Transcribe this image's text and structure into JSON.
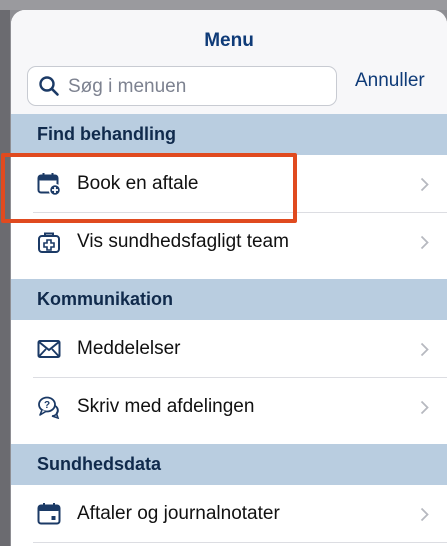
{
  "header": {
    "title": "Menu",
    "search_placeholder": "Søg i menuen",
    "cancel_label": "Annuller"
  },
  "sections": [
    {
      "title": "Find behandling",
      "items": [
        {
          "label": "Book en aftale",
          "icon": "calendar-plus-icon"
        },
        {
          "label": "Vis sundhedsfagligt team",
          "icon": "medical-bag-icon"
        }
      ]
    },
    {
      "title": "Kommunikation",
      "items": [
        {
          "label": "Meddelelser",
          "icon": "envelope-icon"
        },
        {
          "label": "Skriv med afdelingen",
          "icon": "chat-bubbles-icon"
        }
      ]
    },
    {
      "title": "Sundhedsdata",
      "items": [
        {
          "label": "Aftaler og journalnotater",
          "icon": "calendar-icon"
        }
      ]
    }
  ],
  "colors": {
    "brand_navy": "#0f3b78",
    "section_bg": "#b9cde0",
    "highlight": "#e04a1f"
  }
}
